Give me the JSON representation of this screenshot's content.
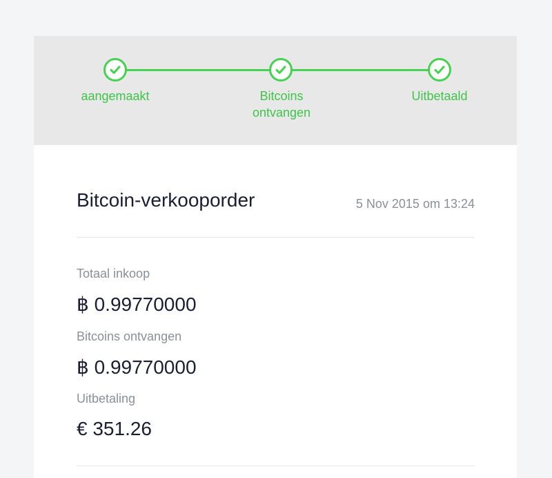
{
  "progress": {
    "steps": [
      {
        "label": "aangemaakt",
        "completed": true
      },
      {
        "label": "Bitcoins\nontvangen",
        "completed": true
      },
      {
        "label": "Uitbetaald",
        "completed": true
      }
    ],
    "color": "#44d24f"
  },
  "order": {
    "title": "Bitcoin-verkooporder",
    "date": "5 Nov 2015 om 13:24"
  },
  "fields": [
    {
      "label": "Totaal inkoop",
      "value": "฿ 0.99770000"
    },
    {
      "label": "Bitcoins ontvangen",
      "value": "฿ 0.99770000"
    },
    {
      "label": "Uitbetaling",
      "value": "€ 351.26"
    }
  ]
}
